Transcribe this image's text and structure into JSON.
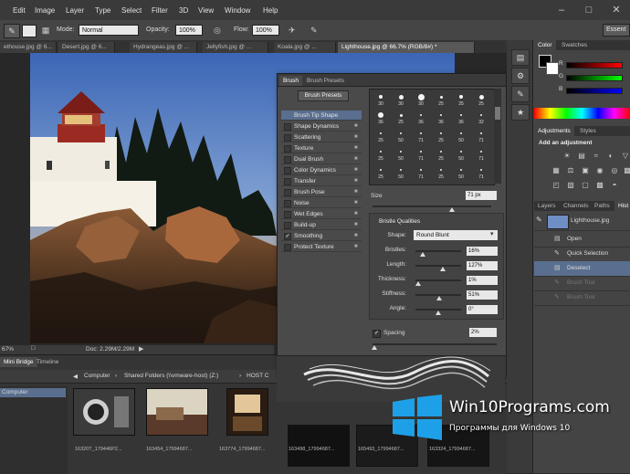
{
  "menubar": {
    "items": [
      "Edit",
      "Image",
      "Layer",
      "Type",
      "Select",
      "Filter",
      "3D",
      "View",
      "Window",
      "Help"
    ],
    "right_button": "Essent"
  },
  "options": {
    "mode_label": "Mode:",
    "mode_value": "Normal",
    "opacity_label": "Opacity:",
    "opacity_value": "100%",
    "flow_label": "Flow:",
    "flow_value": "100%"
  },
  "tabs": [
    {
      "label": "ethouse.jpg @ 6...",
      "active": false
    },
    {
      "label": "Desert.jpg @ 6...",
      "active": false
    },
    {
      "label": "Hydrangeas.jpg @ ...",
      "active": false
    },
    {
      "label": "Jellyfish.jpg @ ...",
      "active": false
    },
    {
      "label": "Koala.jpg @ ...",
      "active": false
    },
    {
      "label": "Lighthouse.jpg @ 66.7% (RGB/8#) *",
      "active": true
    }
  ],
  "status": {
    "zoom": "67%",
    "doc": "Doc: 2.29M/2.29M"
  },
  "brush_panel": {
    "tabs": [
      "Brush",
      "Brush Presets"
    ],
    "presets_button": "Brush Presets",
    "items": [
      {
        "label": "Brush Tip Shape",
        "checked": false,
        "selected": true
      },
      {
        "label": "Shape Dynamics",
        "checked": false
      },
      {
        "label": "Scattering",
        "checked": false
      },
      {
        "label": "Texture",
        "checked": false
      },
      {
        "label": "Dual Brush",
        "checked": false
      },
      {
        "label": "Color Dynamics",
        "checked": false
      },
      {
        "label": "Transfer",
        "checked": false
      },
      {
        "label": "Brush Pose",
        "checked": false
      },
      {
        "label": "Noise",
        "checked": false
      },
      {
        "label": "Wet Edges",
        "checked": false
      },
      {
        "label": "Build-up",
        "checked": false
      },
      {
        "label": "Smoothing",
        "checked": true
      },
      {
        "label": "Protect Texture",
        "checked": false
      }
    ],
    "tip_sizes": [
      [
        "30",
        "30",
        "30",
        "25",
        "25",
        "25"
      ],
      [
        "36",
        "25",
        "36",
        "36",
        "36",
        "32"
      ],
      [
        "25",
        "50",
        "71",
        "25",
        "50",
        "71"
      ],
      [
        "25",
        "50",
        "71",
        "25",
        "50",
        "71"
      ],
      [
        "25",
        "50",
        "71",
        "25",
        "50",
        "71"
      ]
    ],
    "size_label": "Size",
    "size_value": "71 px",
    "bristle_title": "Bristle Qualities",
    "shape_label": "Shape:",
    "shape_value": "Round Blunt",
    "bristles": [
      {
        "label": "Bristles:",
        "value": "16%",
        "level": 0.16
      },
      {
        "label": "Length:",
        "value": "127%",
        "level": 0.6
      },
      {
        "label": "Thickness:",
        "value": "1%",
        "level": 0.05
      },
      {
        "label": "Stiffness:",
        "value": "51%",
        "level": 0.51
      },
      {
        "label": "Angle:",
        "value": "0°",
        "level": 0.5
      }
    ],
    "spacing_label": "Spacing",
    "spacing_value": "2%"
  },
  "bridge": {
    "tabs": [
      "Mini Bridge",
      "Timeline"
    ],
    "breadcrumb": [
      "Computer",
      "Shared Folders (\\\\vmware-host) (Z:)",
      "HOST C"
    ],
    "sidebar_item": "Computer",
    "thumb_labels": [
      "16320T_179446P2...",
      "163454_17994687...",
      "163774_17994687...",
      "163498_17994687...",
      "165493_17994687...",
      "163324_17994687..."
    ]
  },
  "color_panel": {
    "tabs": [
      "Color",
      "Swatches"
    ],
    "channels": [
      "R",
      "G",
      "B"
    ]
  },
  "adjustments": {
    "tabs": [
      "Adjustments",
      "Styles"
    ],
    "title": "Add an adjustment"
  },
  "layers": {
    "tabs": [
      "Layers",
      "Channels",
      "Paths",
      "Hist"
    ],
    "snapshot": "Lighthouse.jpg",
    "states": [
      {
        "label": "Open",
        "style": "normal"
      },
      {
        "label": "Quick Selection",
        "style": "normal"
      },
      {
        "label": "Deselect",
        "style": "active"
      },
      {
        "label": "Brush Tool",
        "style": "dim"
      },
      {
        "label": "Brush Tool",
        "style": "dim"
      }
    ]
  },
  "watermark": {
    "title": "Win10Programs.com",
    "subtitle": "Программы для Windows 10"
  },
  "colors": {
    "app_bg": "#2b2b2b",
    "panel_bg": "#4a4a4a",
    "selected": "#5a6f8f",
    "sky": "#6f8fc4"
  }
}
